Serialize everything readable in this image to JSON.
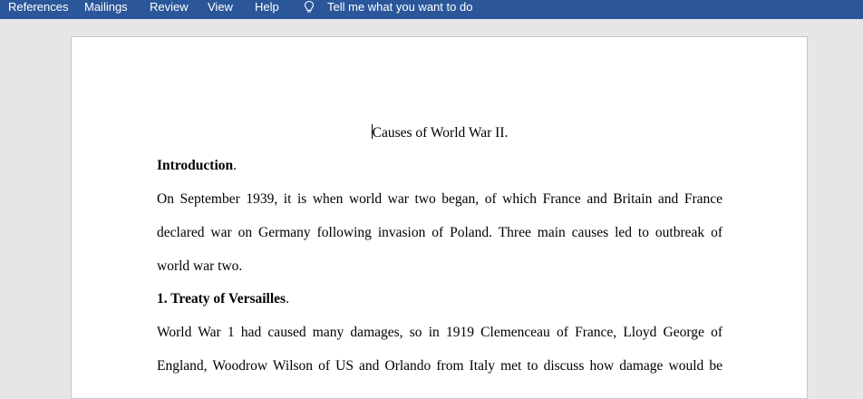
{
  "ribbon": {
    "tabs": [
      {
        "label": "References"
      },
      {
        "label": "Mailings"
      },
      {
        "label": "Review"
      },
      {
        "label": "View"
      },
      {
        "label": "Help"
      }
    ],
    "tell_me": "Tell me what you want to do",
    "tell_me_icon": "lightbulb-icon",
    "color": "#2b579a"
  },
  "document": {
    "title": "Causes of World War II.",
    "intro_heading": "Introduction",
    "intro_heading_suffix": ".",
    "intro_lines": [
      "On September 1939, it is when world war two began, of which France and Britain and France",
      "declared war on Germany following invasion of Poland. Three main causes led to outbreak of",
      "world war two."
    ],
    "section1_heading": "1. Treaty of Versailles",
    "section1_heading_suffix": ".",
    "section1_lines": [
      "World War 1 had caused many damages, so in 1919 Clemenceau of France, Lloyd George of",
      "England, Woodrow Wilson of US and Orlando from Italy met to discuss how damage would be"
    ]
  }
}
